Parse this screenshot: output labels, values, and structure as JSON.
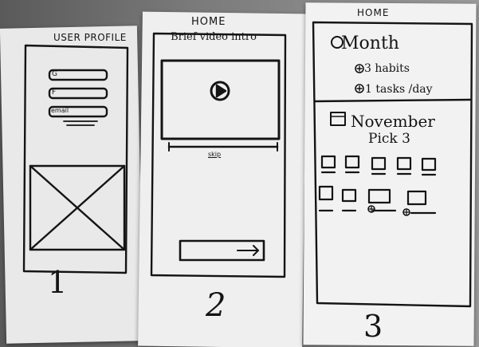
{
  "sheets": [
    {
      "title": "USER PROFILE",
      "fields": [
        "G",
        "F",
        "email"
      ],
      "number": "1"
    },
    {
      "title": "HOME",
      "subtitle": "Brief video intro",
      "skip_label": "skip",
      "number": "2"
    },
    {
      "title": "HOME",
      "month_label": "Month",
      "habits_label": "3 habits",
      "tasks_label": "1 tasks /day",
      "calendar_label": "November",
      "pick_label": "Pick 3",
      "number": "3"
    }
  ],
  "colors": {
    "paper": "#ededed",
    "ink": "#141414",
    "background": "#6e6e6e"
  }
}
